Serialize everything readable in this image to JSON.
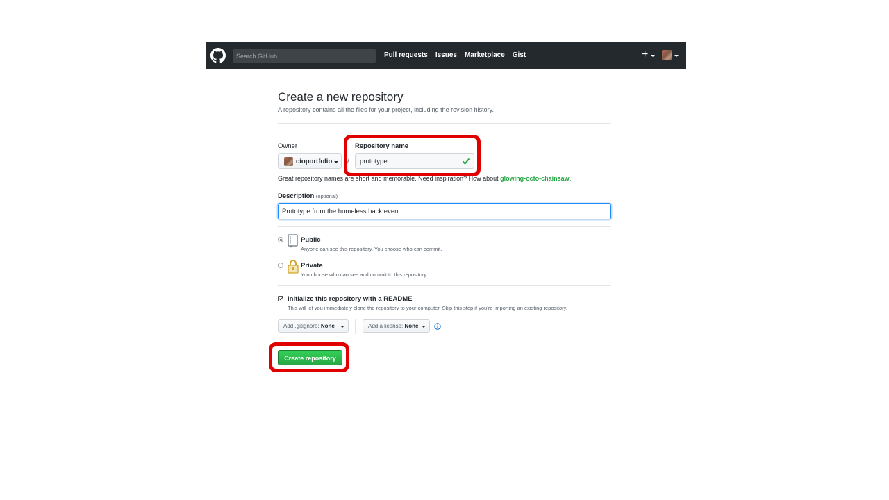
{
  "header": {
    "search_placeholder": "Search GitHub",
    "nav": [
      "Pull requests",
      "Issues",
      "Marketplace",
      "Gist"
    ],
    "new_label": "+",
    "logo_icon": "github-octocat-icon"
  },
  "page": {
    "title": "Create a new repository",
    "subtitle": "A repository contains all the files for your project, including the revision history."
  },
  "form": {
    "owner_label": "Owner",
    "owner_value": "cioportfolio",
    "separator": "/",
    "repo_label": "Repository name",
    "repo_value": "prototype",
    "hint_prefix": "Great repository names are short and memorable. Need inspiration? How about ",
    "hint_suggestion": "glowing-octo-chainsaw",
    "hint_suffix": ".",
    "description_label": "Description",
    "description_optional": "(optional)",
    "description_value": "Prototype from the homeless hack event",
    "public_title": "Public",
    "public_desc": "Anyone can see this repository. You choose who can commit.",
    "private_title": "Private",
    "private_desc": "You choose who can see and commit to this repository.",
    "visibility_selected": "Public",
    "init_title": "Initialize this repository with a README",
    "init_desc": "This will let you immediately clone the repository to your computer. Skip this step if you’re importing an existing repository.",
    "init_checked": true,
    "gitignore_label": "Add .gitignore:",
    "gitignore_value": "None",
    "license_label": "Add a license:",
    "license_value": "None",
    "submit_label": "Create repository"
  },
  "colors": {
    "header_bg": "#24292e",
    "primary_green": "#28a745",
    "highlight_red": "#e00000",
    "focus_blue": "#2188ff"
  }
}
